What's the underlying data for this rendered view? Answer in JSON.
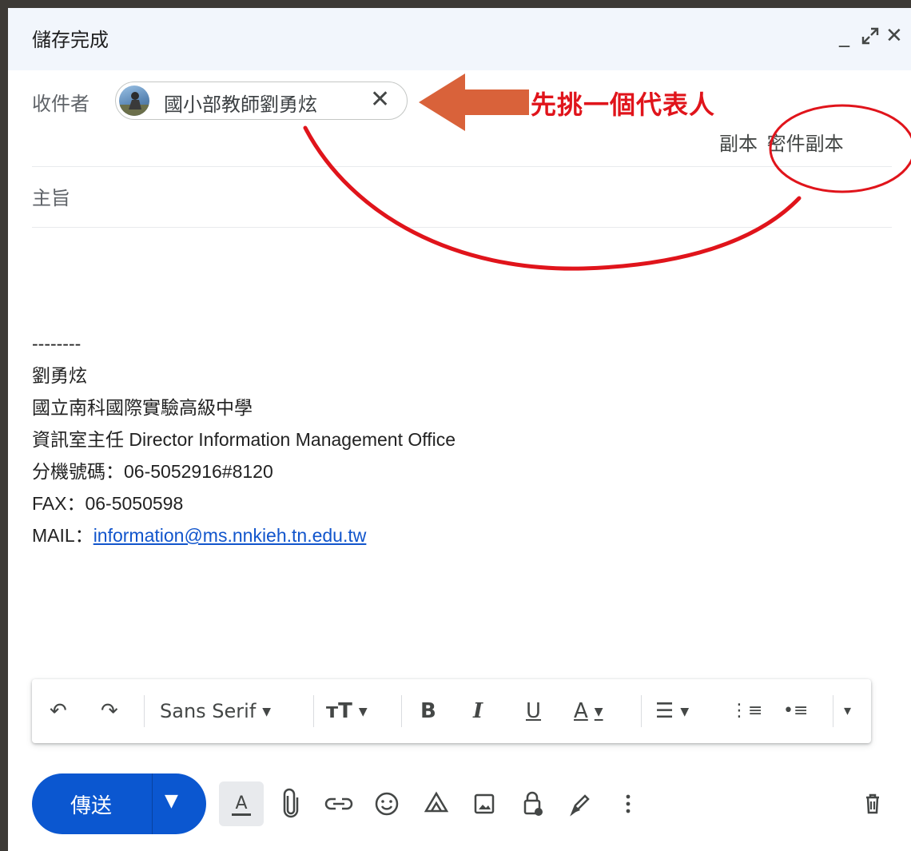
{
  "window": {
    "title": "儲存完成",
    "controls": {
      "minimize": "_",
      "expand": "⤢",
      "close": "✕"
    }
  },
  "recipients": {
    "label": "收件者",
    "chip": {
      "name": "國小部教師劉勇炫",
      "remove": "✕"
    },
    "cc_label": "副本",
    "bcc_label": "密件副本"
  },
  "annotation": {
    "text": "先挑一個代表人",
    "color": "#e0141b",
    "arrow_color": "#d9623a"
  },
  "subject": {
    "placeholder": "主旨"
  },
  "signature": {
    "dashes": "--------",
    "name": "劉勇炫",
    "school": "國立南科國際實驗高級中學",
    "title": "資訊室主任 Director Information Management Office",
    "ext": "分機號碼：06-5052916#8120",
    "fax": "FAX：06-5050598",
    "mail_label": "MAIL：",
    "mail": "information@ms.nnkieh.tn.edu.tw"
  },
  "format_toolbar": {
    "undo": "↶",
    "redo": "↷",
    "font": "Sans Serif",
    "size": "тT",
    "bold": "B",
    "italic": "I",
    "underline": "U",
    "text_color": "A",
    "align": "☰",
    "numbered": "⋮≡",
    "bulleted": "•≡",
    "more": "▾"
  },
  "send": {
    "label": "傳送",
    "color": "#0b57d0"
  },
  "bottom_icons": [
    "formatting-icon",
    "attach-icon",
    "link-icon",
    "emoji-icon",
    "drive-icon",
    "photo-icon",
    "confidential-icon",
    "signature-icon",
    "more-options-icon",
    "trash-icon"
  ]
}
